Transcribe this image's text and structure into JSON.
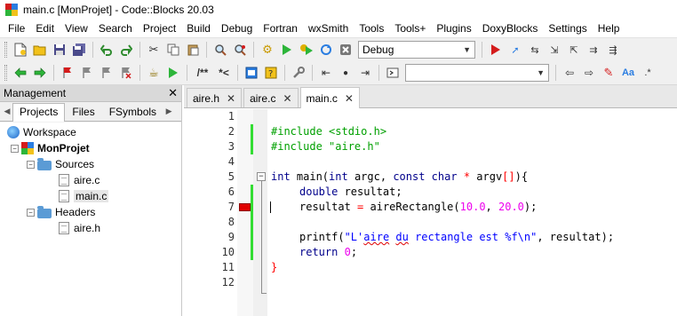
{
  "window": {
    "title": "main.c [MonProjet] - Code::Blocks 20.03"
  },
  "menu": [
    "File",
    "Edit",
    "View",
    "Search",
    "Project",
    "Build",
    "Debug",
    "Fortran",
    "wxSmith",
    "Tools",
    "Tools+",
    "Plugins",
    "DoxyBlocks",
    "Settings",
    "Help"
  ],
  "toolbar": {
    "build_target": "Debug",
    "search_value": "",
    "comment_block_label": "/**",
    "comment_line_label": "*<",
    "icons": [
      "new-file-icon",
      "open-icon",
      "save-icon",
      "save-all-icon",
      "undo-icon",
      "redo-icon",
      "cut-icon",
      "copy-icon",
      "paste-icon",
      "find-icon",
      "replace-icon",
      "build-icon",
      "run-icon",
      "build-run-icon",
      "rebuild-icon",
      "abort-icon",
      "debug-icon"
    ]
  },
  "management": {
    "title": "Management",
    "tabs": [
      "Projects",
      "Files",
      "FSymbols"
    ],
    "active_tab": "Projects",
    "tree": {
      "workspace": "Workspace",
      "project": "MonProjet",
      "sources_folder": "Sources",
      "sources": [
        "aire.c",
        "main.c"
      ],
      "headers_folder": "Headers",
      "headers": [
        "aire.h"
      ],
      "selected": "main.c"
    }
  },
  "editor": {
    "tabs": [
      "aire.h",
      "aire.c",
      "main.c"
    ],
    "active_tab": "main.c",
    "line_numbers": [
      "1",
      "2",
      "3",
      "4",
      "5",
      "6",
      "7",
      "8",
      "9",
      "10",
      "11",
      "12"
    ],
    "breakpoint_line": 7,
    "code": {
      "l2_directive": "#include",
      "l2_arg": "<stdio.h>",
      "l3_directive": "#include",
      "l3_arg": "\"aire.h\"",
      "l5_int": "int",
      "l5_name": " main(",
      "l5_int2": "int",
      "l5_argc": " argc, ",
      "l5_const": "const",
      "l5_char": "char",
      "l5_star": "*",
      "l5_argv": " argv",
      "l5_brackets": "[]",
      "l5_close": "){",
      "l6_double": "double",
      "l6_rest": " resultat;",
      "l7_lhs": "resultat ",
      "l7_eq": "=",
      "l7_call": " aireRectangle(",
      "l7_a": "10.0",
      "l7_comma": ", ",
      "l7_b": "20.0",
      "l7_end": ");",
      "l9_call": "printf(",
      "l9_s1": "\"L'",
      "l9_s2": "aire",
      "l9_s3": " ",
      "l9_s4": "du",
      "l9_s5": " rectangle est %f\\n\"",
      "l9_end": ", resultat);",
      "l10_return": "return",
      "l10_zero": "0",
      "l10_semi": ";",
      "l11_brace": "}"
    }
  }
}
